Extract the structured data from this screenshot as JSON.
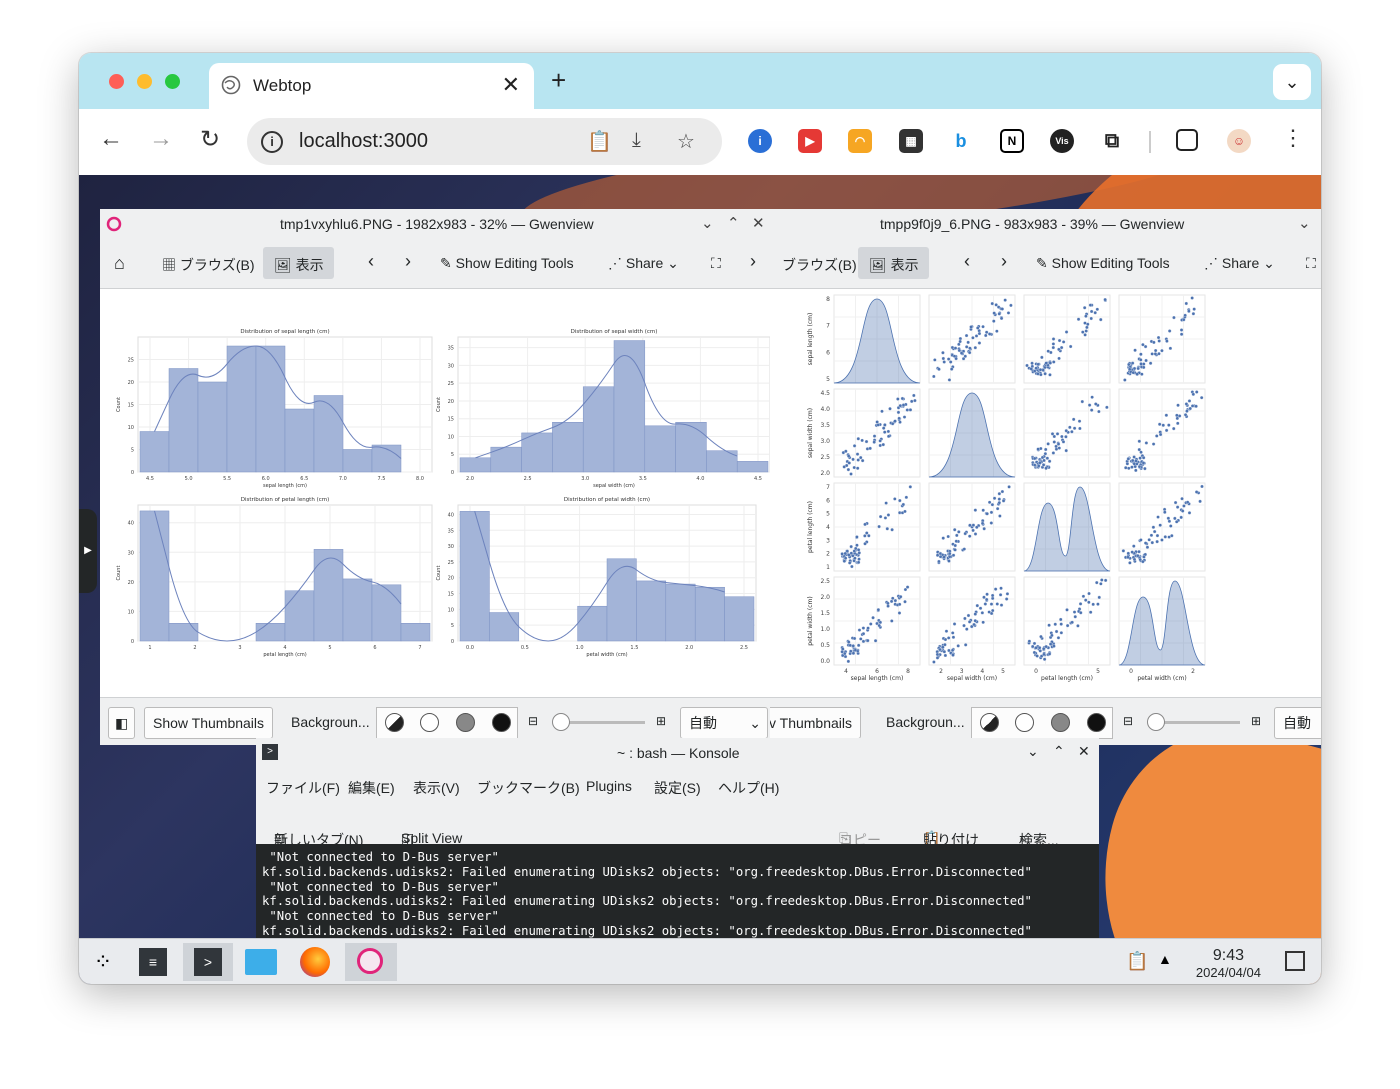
{
  "browser": {
    "tab_title": "Webtop",
    "url": "localhost:3000",
    "tab_close": "✕",
    "new_tab": "+"
  },
  "gwenview_left": {
    "title": "tmp1vxyhlu6.PNG - 1982x983 - 32% — Gwenview",
    "browse_label": "ブラウズ(B)",
    "view_label": "表示",
    "editing_tools": "Show Editing Tools",
    "share": "Share",
    "show_thumbnails": "Show Thumbnails",
    "background": "Backgroun...",
    "zoom_mode": "自動"
  },
  "gwenview_right": {
    "title": "tmpp9f0j9_6.PNG - 983x983 - 39% — Gwenview",
    "browse_label": "ブラウズ(B)",
    "view_label": "表示",
    "editing_tools": "Show Editing Tools",
    "share": "Share",
    "show_thumbnails": "v Thumbnails",
    "background": "Backgroun...",
    "zoom_mode": "自動"
  },
  "histograms": {
    "chart_data": [
      {
        "type": "bar",
        "title": "Distribution of sepal length (cm)",
        "xlabel": "sepal length (cm)",
        "ylabel": "Count",
        "categories": [
          "4.3",
          "4.7",
          "5.0",
          "5.4",
          "5.8",
          "6.1",
          "6.5",
          "6.8",
          "7.2",
          "7.5"
        ],
        "values": [
          9,
          23,
          20,
          28,
          28,
          14,
          17,
          5,
          6,
          0
        ],
        "xticks": [
          "4.5",
          "5.0",
          "5.5",
          "6.0",
          "6.5",
          "7.0",
          "7.5",
          "8.0"
        ],
        "yticks": [
          "0",
          "5",
          "10",
          "15",
          "20",
          "25"
        ],
        "ylim": [
          0,
          30
        ]
      },
      {
        "type": "bar",
        "title": "Distribution of sepal width (cm)",
        "xlabel": "sepal width (cm)",
        "ylabel": "Count",
        "categories": [
          "2.0",
          "2.2",
          "2.4",
          "2.7",
          "2.9",
          "3.1",
          "3.4",
          "3.6",
          "3.8",
          "4.1"
        ],
        "values": [
          4,
          7,
          11,
          14,
          24,
          37,
          13,
          14,
          6,
          3
        ],
        "xticks": [
          "2.0",
          "2.5",
          "3.0",
          "3.5",
          "4.0",
          "4.5"
        ],
        "yticks": [
          "0",
          "5",
          "10",
          "15",
          "20",
          "25",
          "30",
          "35"
        ],
        "ylim": [
          0,
          38
        ]
      },
      {
        "type": "bar",
        "title": "Distribution of petal length (cm)",
        "xlabel": "petal length (cm)",
        "ylabel": "Count",
        "categories": [
          "1.0",
          "1.6",
          "2.2",
          "2.8",
          "3.4",
          "4.0",
          "4.5",
          "5.1",
          "5.7",
          "6.3"
        ],
        "values": [
          44,
          6,
          0,
          0,
          6,
          17,
          31,
          21,
          19,
          6
        ],
        "xticks": [
          "1",
          "2",
          "3",
          "4",
          "5",
          "6",
          "7"
        ],
        "yticks": [
          "0",
          "10",
          "20",
          "30",
          "40"
        ],
        "ylim": [
          0,
          46
        ]
      },
      {
        "type": "bar",
        "title": "Distribution of petal width (cm)",
        "xlabel": "petal width (cm)",
        "ylabel": "Count",
        "categories": [
          "0.1",
          "0.3",
          "0.6",
          "0.8",
          "1.1",
          "1.3",
          "1.6",
          "1.8",
          "2.1",
          "2.3"
        ],
        "values": [
          41,
          9,
          0,
          0,
          11,
          26,
          19,
          18,
          17,
          14
        ],
        "xticks": [
          "0.0",
          "0.5",
          "1.0",
          "1.5",
          "2.0",
          "2.5"
        ],
        "yticks": [
          "0",
          "5",
          "10",
          "15",
          "20",
          "25",
          "30",
          "35",
          "40"
        ],
        "ylim": [
          0,
          43
        ]
      }
    ]
  },
  "pairplot": {
    "row_labels": [
      "sepal length (cm)",
      "sepal width (cm)",
      "petal length (cm)",
      "petal width (cm)"
    ],
    "col_labels": [
      "sepal length (cm)",
      "sepal width (cm)",
      "petal length (cm)",
      "petal width (cm)"
    ],
    "row_ticks": [
      [
        "5",
        "6",
        "7",
        "8"
      ],
      [
        "2.0",
        "2.5",
        "3.0",
        "3.5",
        "4.0",
        "4.5"
      ],
      [
        "1",
        "2",
        "3",
        "4",
        "5",
        "6",
        "7"
      ],
      [
        "0.0",
        "0.5",
        "1.0",
        "1.5",
        "2.0",
        "2.5"
      ]
    ],
    "col_ticks": [
      [
        "4",
        "6",
        "8"
      ],
      [
        "2",
        "3",
        "4",
        "5"
      ],
      [
        "0",
        "5"
      ],
      [
        "0",
        "2"
      ]
    ],
    "accent": "#4c72b0"
  },
  "konsole": {
    "title": "~ : bash — Konsole",
    "menu": [
      "ファイル(F)",
      "編集(E)",
      "表示(V)",
      "ブックマーク(B)",
      "Plugins",
      "設定(S)",
      "ヘルプ(H)"
    ],
    "new_tab": "新しいタブ(N)",
    "split_view": "Split View",
    "copy": "コピー",
    "paste": "貼り付け",
    "search": "検索...",
    "lines": [
      " \"Not connected to D-Bus server\"",
      "kf.solid.backends.udisks2: Failed enumerating UDisks2 objects: \"org.freedesktop.DBus.Error.Disconnected\"",
      " \"Not connected to D-Bus server\"",
      "kf.solid.backends.udisks2: Failed enumerating UDisks2 objects: \"org.freedesktop.DBus.Error.Disconnected\"",
      " \"Not connected to D-Bus server\"",
      "kf.solid.backends.udisks2: Failed enumerating UDisks2 objects: \"org.freedesktop.DBus.Error.Disconnected\""
    ]
  },
  "taskbar": {
    "time": "9:43",
    "date": "2024/04/04"
  }
}
